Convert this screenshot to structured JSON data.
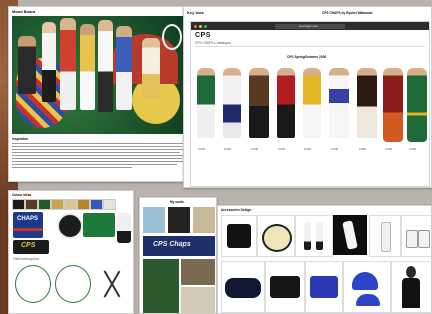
{
  "mood": {
    "label": "Mood Board",
    "heading": "Inspiration"
  },
  "key_look": {
    "left_title": "Key look",
    "right_title": "CPS CHAPS by Ryuhei Watanabe",
    "browser_url": "cpschaps.com",
    "brand": "CPS",
    "brand_sub": "CPS CHAPS  ▸  catalogue",
    "collection": "CPS Spring/Summer 2026",
    "look_caption": "LOOK"
  },
  "colors": {
    "label": "Colour ideas",
    "swatches": [
      "#1a1a1a",
      "#5a3a22",
      "#1f5d2a",
      "#c8a44a",
      "#d9c59a",
      "#b8852a",
      "#3b56b8",
      "#e8e4dc"
    ]
  },
  "flat_label": "Flat/Moodlo/ganoc",
  "prints": {
    "label": "My cards"
  },
  "accessories": {
    "label": "Accessories Design"
  },
  "graphics": {
    "chaps": "CHAPS",
    "cps": "CPS",
    "cps_logo": "CPS Chaps"
  }
}
